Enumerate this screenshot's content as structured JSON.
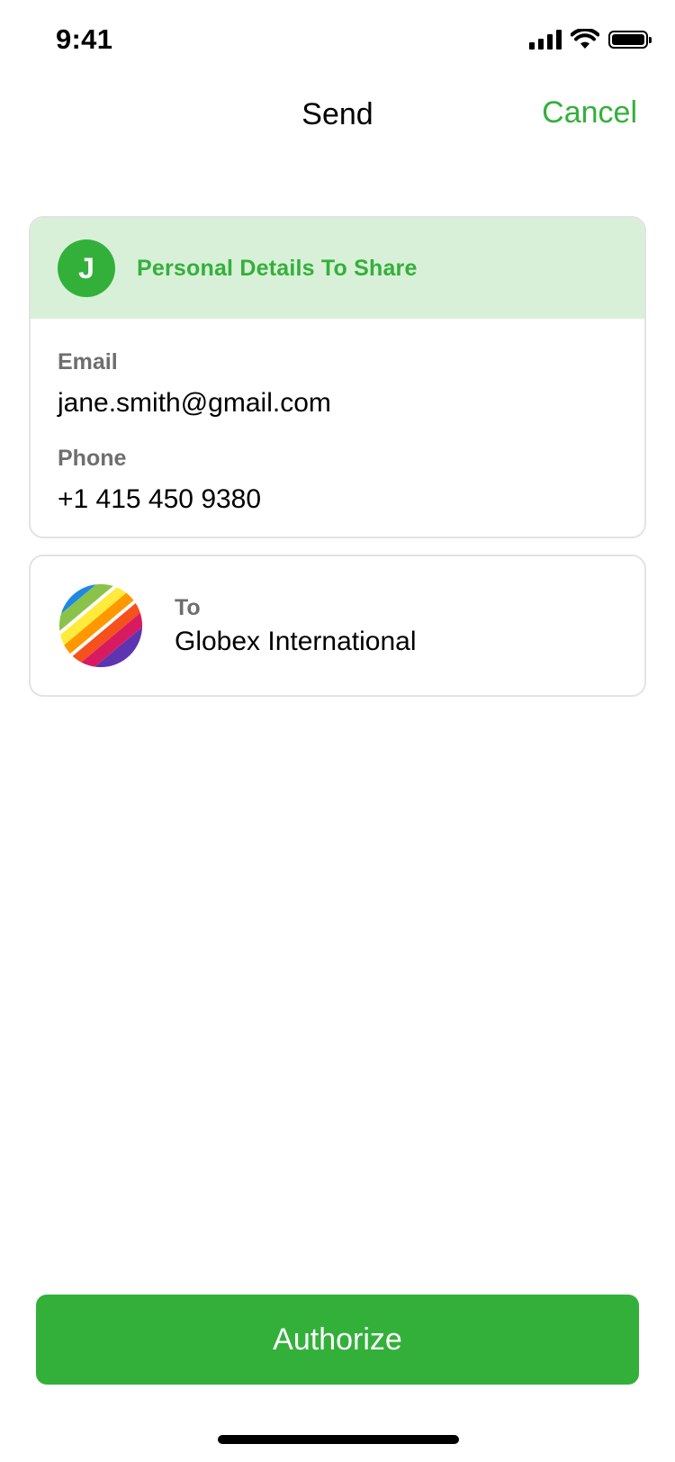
{
  "status_bar": {
    "time": "9:41"
  },
  "header": {
    "title": "Send",
    "cancel_label": "Cancel"
  },
  "details_card": {
    "avatar_initial": "J",
    "title": "Personal Details To Share",
    "fields": [
      {
        "label": "Email",
        "value": "jane.smith@gmail.com"
      },
      {
        "label": "Phone",
        "value": "+1 415 450 9380"
      }
    ]
  },
  "recipient_card": {
    "to_label": "To",
    "name": "Globex International",
    "logo_icon": "multicolor-globe-logo-icon"
  },
  "actions": {
    "authorize_label": "Authorize"
  },
  "colors": {
    "accent": "#33b03a",
    "header_bg": "#d8f0d8",
    "muted_text": "#6e6e6e"
  }
}
